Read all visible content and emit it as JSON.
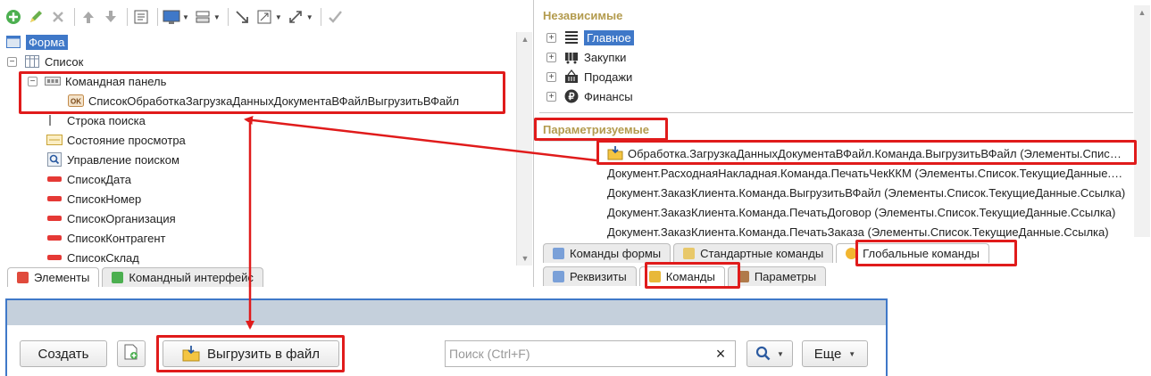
{
  "left_tree": {
    "items": [
      {
        "label": "Форма",
        "icon": "form-icon"
      },
      {
        "label": "Список",
        "icon": "table-icon"
      },
      {
        "label": "Командная панель",
        "icon": "command-panel-icon"
      },
      {
        "label": "СписокОбработкаЗагрузкаДанныхДокументаВФайлВыгрузитьВФайл",
        "icon": "ok-button-icon",
        "badge": "OK"
      },
      {
        "label": "Строка поиска",
        "icon": "search-string-icon"
      },
      {
        "label": "Состояние просмотра",
        "icon": "view-state-icon"
      },
      {
        "label": "Управление поиском",
        "icon": "search-control-icon"
      },
      {
        "label": "СписокДата",
        "icon": "field-icon"
      },
      {
        "label": "СписокНомер",
        "icon": "field-icon"
      },
      {
        "label": "СписокОрганизация",
        "icon": "field-icon"
      },
      {
        "label": "СписокКонтрагент",
        "icon": "field-icon"
      },
      {
        "label": "СписокСклад",
        "icon": "field-icon"
      }
    ],
    "tabs": [
      "Элементы",
      "Командный интерфейс"
    ]
  },
  "right_panel": {
    "section_independent": "Независимые",
    "independent_items": [
      "Главное",
      "Закупки",
      "Продажи",
      "Финансы"
    ],
    "section_parametrized": "Параметризуемые",
    "parametrized_items": [
      "Обработка.ЗагрузкаДанныхДокументаВФайл.Команда.ВыгрузитьВФайл (Элементы.Список.ТекущиеДанные.Ссылка)",
      "Документ.РасходнаяНакладная.Команда.ПечатьЧекККМ (Элементы.Список.ТекущиеДанные.Ссылка)",
      "Документ.ЗаказКлиента.Команда.ВыгрузитьВФайл (Элементы.Список.ТекущиеДанные.Ссылка)",
      "Документ.ЗаказКлиента.Команда.ПечатьДоговор (Элементы.Список.ТекущиеДанные.Ссылка)",
      "Документ.ЗаказКлиента.Команда.ПечатьЗаказа (Элементы.Список.ТекущиеДанные.Ссылка)"
    ],
    "command_tabs": [
      "Команды формы",
      "Стандартные команды",
      "Глобальные команды"
    ],
    "property_tabs": [
      "Реквизиты",
      "Команды",
      "Параметры"
    ]
  },
  "form": {
    "create_label": "Создать",
    "export_label": "Выгрузить в файл",
    "search_placeholder": "Поиск (Ctrl+F)",
    "clear_label": "×",
    "more_label": "Еще"
  },
  "colors": {
    "highlight": "#e01b1b",
    "selection": "#3f78c8",
    "section_header": "#b39b4e"
  }
}
